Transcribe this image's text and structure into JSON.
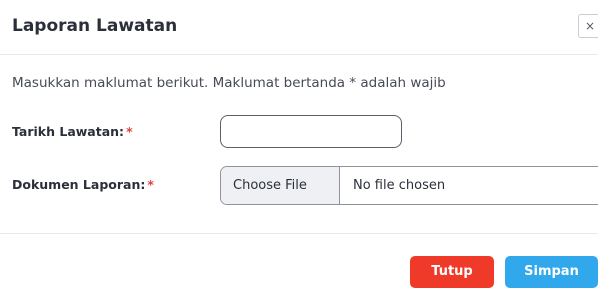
{
  "modal": {
    "title": "Laporan Lawatan",
    "close_glyph": "×",
    "intro": "Masukkan maklumat berikut. Maklumat bertanda * adalah wajib"
  },
  "form": {
    "date_label": "Tarikh Lawatan:",
    "date_value": "",
    "doc_label": "Dokumen Laporan:",
    "required_marker": "*",
    "file_button_label": "Choose File",
    "file_status": "No file chosen"
  },
  "footer": {
    "close_label": "Tutup",
    "save_label": "Simpan"
  },
  "colors": {
    "close_button": "#ef3a2a",
    "save_button": "#31a8ec",
    "required": "#e0433f"
  }
}
